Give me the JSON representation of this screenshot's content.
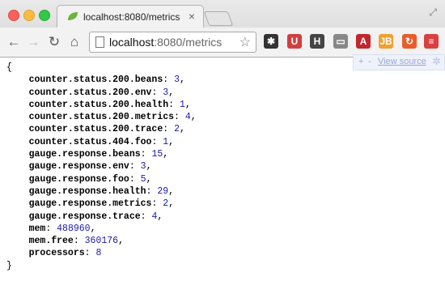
{
  "tab": {
    "title": "localhost:8080/metrics",
    "close": "×"
  },
  "toolbar": {
    "back": "←",
    "forward": "→",
    "reload": "↻",
    "home": "⌂",
    "url_host": "localhost",
    "url_rest": ":8080/metrics",
    "star": "☆"
  },
  "extensions": [
    {
      "name": "asterisk-extension-icon",
      "label": "✱",
      "color": "#333333"
    },
    {
      "name": "ublock-extension-icon",
      "label": "U",
      "color": "#d33e3e"
    },
    {
      "name": "h-extension-icon",
      "label": "H",
      "color": "#444444"
    },
    {
      "name": "cast-icon",
      "label": "▭",
      "color": "#888888"
    },
    {
      "name": "a-extension-icon",
      "label": "A",
      "color": "#c1272d"
    },
    {
      "name": "jb-extension-icon",
      "label": "JB",
      "color": "#f0a030"
    },
    {
      "name": "refresh-extension-icon",
      "label": "↻",
      "color": "#e85d2a"
    },
    {
      "name": "menu-icon",
      "label": "≡",
      "color": "#d94040"
    }
  ],
  "viewsource": {
    "plus": "+",
    "minus": "-",
    "link": "View source",
    "gear": "✲"
  },
  "json": {
    "open": "{",
    "close": "}",
    "entries": [
      {
        "key": "counter.status.200.beans",
        "value": "3"
      },
      {
        "key": "counter.status.200.env",
        "value": "3"
      },
      {
        "key": "counter.status.200.health",
        "value": "1"
      },
      {
        "key": "counter.status.200.metrics",
        "value": "4"
      },
      {
        "key": "counter.status.200.trace",
        "value": "2"
      },
      {
        "key": "counter.status.404.foo",
        "value": "1"
      },
      {
        "key": "gauge.response.beans",
        "value": "15"
      },
      {
        "key": "gauge.response.env",
        "value": "3"
      },
      {
        "key": "gauge.response.foo",
        "value": "5"
      },
      {
        "key": "gauge.response.health",
        "value": "29"
      },
      {
        "key": "gauge.response.metrics",
        "value": "2"
      },
      {
        "key": "gauge.response.trace",
        "value": "4"
      },
      {
        "key": "mem",
        "value": "488960"
      },
      {
        "key": "mem.free",
        "value": "360176"
      },
      {
        "key": "processors",
        "value": "8"
      }
    ]
  }
}
